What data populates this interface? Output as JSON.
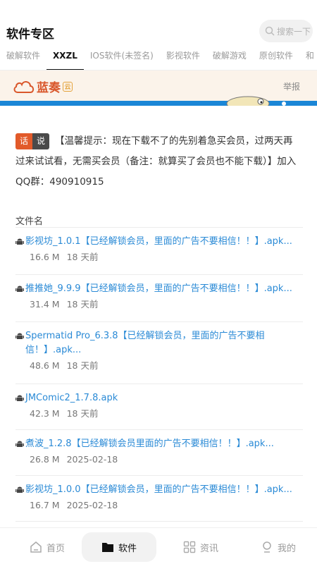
{
  "header": {
    "title": "软件专区",
    "search_placeholder": "搜索一下"
  },
  "tabs": [
    "破解软件",
    "XXZL",
    "IOS软件(未签名)",
    "影视软件",
    "破解游戏",
    "原创软件",
    "和"
  ],
  "active_tab": 1,
  "banner": {
    "brand": "蓝奏",
    "report": "举报"
  },
  "notice": {
    "tag_a": "话",
    "tag_b": "说",
    "text": "【温馨提示：现在下载不了的先别着急买会员，过两天再过来试试看，无需买会员（备注：就算买了会员也不能下载）】加入QQ群：490910915"
  },
  "file_list": {
    "header": "文件名",
    "items": [
      {
        "name": "影视坊_1.0.1【已经解锁会员，里面的广告不要相信！！】.apk...",
        "size": "16.6 M",
        "time": "18 天前"
      },
      {
        "name": "推推她_9.9.9【已经解锁会员，里面的广告不要相信！！】.apk...",
        "size": "31.4 M",
        "time": "18 天前"
      },
      {
        "name": "Spermatid Pro_6.3.8【已经解锁会员，里面的广告不要相信！】.apk...",
        "size": "48.6 M",
        "time": "18 天前"
      },
      {
        "name": "JMComic2_1.7.8.apk",
        "size": "42.3 M",
        "time": "18 天前"
      },
      {
        "name": "煮波_1.2.8【已经解锁会员里面的广告不要相信！！】.apk...",
        "size": "26.8 M",
        "time": "2025-02-18"
      },
      {
        "name": "影视坊_1.0.0【已经解锁会员，里面的广告不要相信！！】.apk...",
        "size": "16.7 M",
        "time": "2025-02-18"
      }
    ]
  },
  "bottom_nav": {
    "home": "首页",
    "software": "软件",
    "news": "资讯",
    "mine": "我的"
  },
  "colors": {
    "link": "#2a8ad6",
    "brand": "#d9572b",
    "tag_orange": "#e25a2a"
  }
}
